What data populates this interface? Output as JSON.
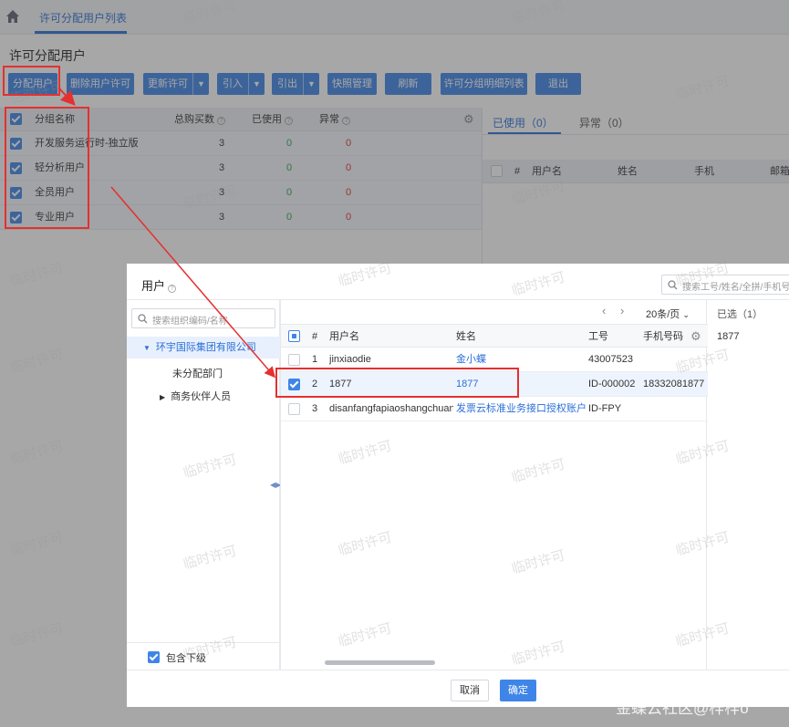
{
  "tab": {
    "label": "许可分配用户列表"
  },
  "page_title": "许可分配用户",
  "toolbar": {
    "assign": "分配用户",
    "delete": "删除用户许可",
    "update": "更新许可",
    "import": "引入",
    "export": "引出",
    "snapshot": "快照管理",
    "refresh": "刷新",
    "detail": "许可分组明细列表",
    "exit": "退出"
  },
  "group_table": {
    "columns": {
      "name": "分组名称",
      "total": "总购买数",
      "used": "已使用",
      "abnormal": "异常"
    },
    "rows": [
      {
        "name": "开发服务运行时-独立版",
        "total": "3",
        "used": "0",
        "abnormal": "0"
      },
      {
        "name": "轻分析用户",
        "total": "3",
        "used": "0",
        "abnormal": "0"
      },
      {
        "name": "全员用户",
        "total": "3",
        "used": "0",
        "abnormal": "0"
      },
      {
        "name": "专业用户",
        "total": "3",
        "used": "0",
        "abnormal": "0"
      }
    ]
  },
  "right_panel": {
    "tab_used": "已使用（0）",
    "tab_abnormal": "异常（0）",
    "columns": {
      "hash": "#",
      "username": "用户名",
      "name": "姓名",
      "phone": "手机",
      "email": "邮箱"
    }
  },
  "modal": {
    "title": "用户",
    "search_placeholder": "搜索工号/姓名/全拼/手机号",
    "tree_search_placeholder": "搜索组织编码/名称",
    "tree": {
      "root": "环宇国际集团有限公司",
      "child1": "未分配部门",
      "child2": "商务伙伴人员"
    },
    "include_sub": "包含下级",
    "pager": {
      "page_size": "20条/页"
    },
    "columns": {
      "hash": "#",
      "username": "用户名",
      "name": "姓名",
      "emp_no": "工号",
      "phone": "手机号码"
    },
    "rows": [
      {
        "no": "1",
        "username": "jinxiaodie",
        "name": "金小蝶",
        "emp_no": "43007523",
        "phone": ""
      },
      {
        "no": "2",
        "username": "1877",
        "name": "1877",
        "emp_no": "ID-000002",
        "phone": "18332081877"
      },
      {
        "no": "3",
        "username": "disanfangfapiaoshangchuan",
        "name": "发票云标准业务接口授权账户",
        "emp_no": "ID-FPY",
        "phone": ""
      }
    ],
    "selected_title": "已选（1）",
    "selected_items": [
      "1877"
    ],
    "cancel": "取消",
    "ok": "确定"
  },
  "watermark": "临时许可",
  "corner_watermark": "金蝶云社区@梓梓o"
}
